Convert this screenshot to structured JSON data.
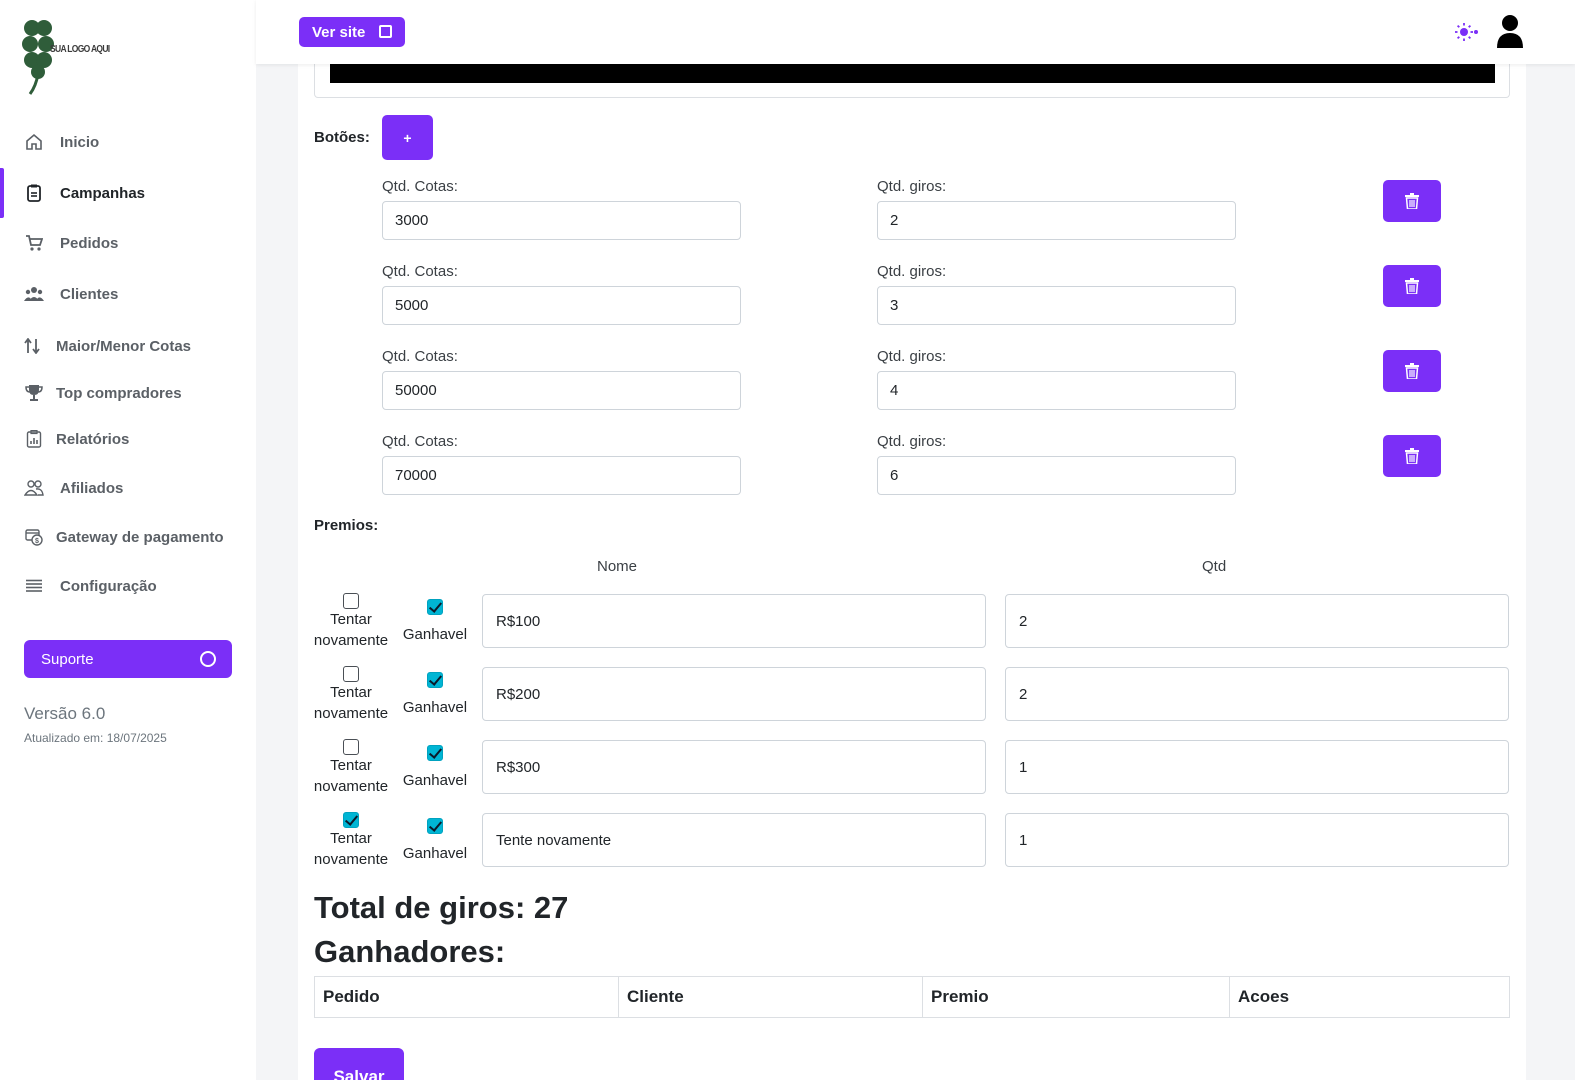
{
  "brand": {
    "logo_text": "SUA LOGO AQUI",
    "accent": "#7b2ff7",
    "check_color": "#00b5d4"
  },
  "sidebar": {
    "items": [
      {
        "label": "Inicio",
        "icon": "home-icon"
      },
      {
        "label": "Campanhas",
        "icon": "clipboard-icon",
        "active": true
      },
      {
        "label": "Pedidos",
        "icon": "cart-icon"
      },
      {
        "label": "Clientes",
        "icon": "users-icon"
      },
      {
        "label": "Maior/Menor Cotas",
        "icon": "sort-arrows-icon"
      },
      {
        "label": "Top compradores",
        "icon": "trophy-icon"
      },
      {
        "label": "Relatórios",
        "icon": "report-icon"
      },
      {
        "label": "Afiliados",
        "icon": "people-icon"
      },
      {
        "label": "Gateway de pagamento",
        "icon": "payment-gateway-icon"
      },
      {
        "label": "Configuração",
        "icon": "menu-lines-icon"
      }
    ],
    "support_label": "Suporte",
    "version": "Versão 6.0",
    "updated": "Atualizado em: 18/07/2025"
  },
  "topbar": {
    "view_site_label": "Ver site"
  },
  "buttons_section": {
    "label": "Botões:",
    "add_label": "+",
    "rows": [
      {
        "cotas_label": "Qtd. Cotas:",
        "cotas": "3000",
        "giros_label": "Qtd. giros:",
        "giros": "2"
      },
      {
        "cotas_label": "Qtd. Cotas:",
        "cotas": "5000",
        "giros_label": "Qtd. giros:",
        "giros": "3"
      },
      {
        "cotas_label": "Qtd. Cotas:",
        "cotas": "50000",
        "giros_label": "Qtd. giros:",
        "giros": "4"
      },
      {
        "cotas_label": "Qtd. Cotas:",
        "cotas": "70000",
        "giros_label": "Qtd. giros:",
        "giros": "6"
      }
    ]
  },
  "prizes": {
    "label": "Premios:",
    "col_name": "Nome",
    "col_qty": "Qtd",
    "retry_label_1": "Tentar",
    "retry_label_2": "novamente",
    "winnable_label": "Ganhavel",
    "rows": [
      {
        "retry": false,
        "winnable": true,
        "name": "R$100",
        "qty": "2"
      },
      {
        "retry": false,
        "winnable": true,
        "name": "R$200",
        "qty": "2"
      },
      {
        "retry": false,
        "winnable": true,
        "name": "R$300",
        "qty": "1"
      },
      {
        "retry": true,
        "winnable": true,
        "name": "Tente novamente",
        "qty": "1"
      }
    ]
  },
  "total_spins": "Total de giros: 27",
  "winners": {
    "title": "Ganhadores:",
    "columns": [
      "Pedido",
      "Cliente",
      "Premio",
      "Acoes"
    ]
  },
  "save_label": "Salvar"
}
